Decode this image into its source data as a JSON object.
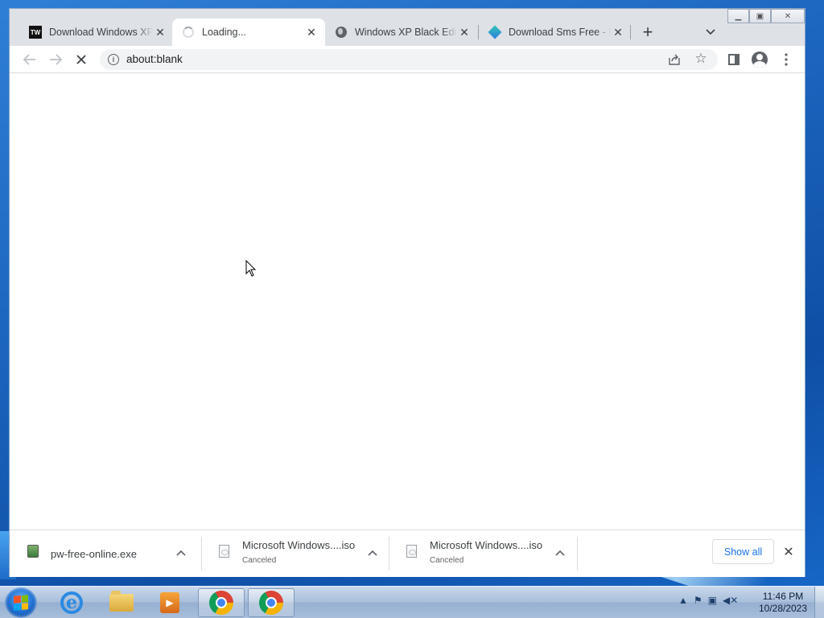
{
  "browser": {
    "tabs": [
      {
        "title": "Download Windows XP",
        "favicon": "tw-favicon-icon",
        "active": false
      },
      {
        "title": "Loading...",
        "favicon": "loading-spinner-icon",
        "active": true
      },
      {
        "title": "Windows XP Black Edition",
        "favicon": "globe-icon",
        "active": false
      },
      {
        "title": "Download Sms Free - B",
        "favicon": "gem-favicon-icon",
        "active": false
      }
    ],
    "address": "about:blank"
  },
  "downloads": {
    "items": [
      {
        "name": "pw-free-online.exe",
        "status": ""
      },
      {
        "name": "Microsoft Windows....iso",
        "status": "Canceled"
      },
      {
        "name": "Microsoft Windows....iso",
        "status": "Canceled"
      }
    ],
    "show_all": "Show all"
  },
  "taskbar": {
    "time": "11:46 PM",
    "date": "10/28/2023"
  }
}
